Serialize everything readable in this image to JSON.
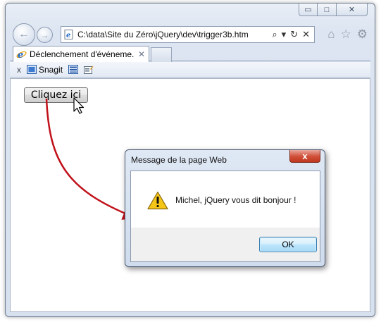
{
  "browser": {
    "address": "C:\\data\\Site du Zéro\\jQuery\\dev\\trigger3b.htm",
    "tab_label": "Déclenchement d'événeme...",
    "tab_close": "✕",
    "window_controls": {
      "minimize": "▭",
      "maximize": "□",
      "close": "✕"
    },
    "address_tools": {
      "search": "⌕",
      "dropdown": "▾",
      "refresh": "↻",
      "stop": "✕"
    },
    "right_icons": {
      "home": "⌂",
      "favorites": "☆",
      "settings": "⚙"
    }
  },
  "command_bar": {
    "close": "x",
    "snagit_label": "Snagit"
  },
  "page": {
    "button_label": "Cliquez ici"
  },
  "dialog": {
    "title": "Message de la page Web",
    "close": "x",
    "message": "Michel, jQuery vous dit bonjour !",
    "ok_label": "OK"
  },
  "colors": {
    "arrow": "#c0111a",
    "ie_blue": "#1b64c4",
    "warning_yellow": "#f5c518"
  }
}
